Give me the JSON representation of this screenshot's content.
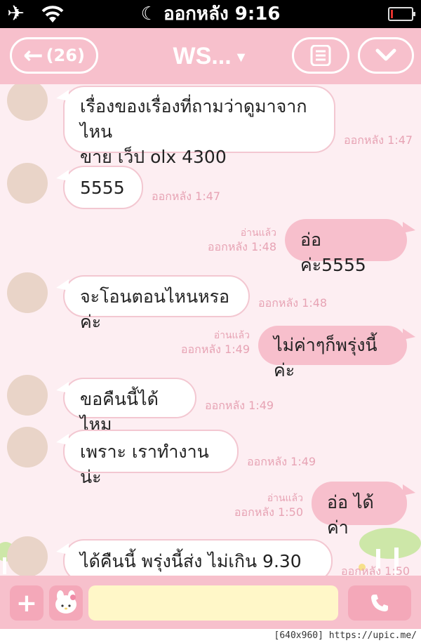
{
  "status_bar": {
    "time": "ออกหลัง 9:16",
    "clock_icon": "moon-icon",
    "signal": "wifi-icon",
    "mode": "airplane-icon",
    "battery_level": 0.1
  },
  "header": {
    "back_label": "(26)",
    "title": "WS...",
    "back_icon": "arrow-left-icon",
    "menu_icon": "menu-icon",
    "expand_icon": "chevron-down-icon"
  },
  "messages": [
    {
      "from": "them",
      "lines": [
        "เรื่องของเรื่องที่ถามว่าดูมาจากไหน",
        "ขาย  เว็ป  olx  4300"
      ],
      "time": "ออกหลัง 1:47"
    },
    {
      "from": "them",
      "text": "5555",
      "time": "ออกหลัง 1:47"
    },
    {
      "from": "me",
      "text": "อ่อ  ค่ะ5555",
      "read": "อ่านแล้ว",
      "time": "ออกหลัง 1:48"
    },
    {
      "from": "them",
      "text": "จะโอนตอนไหนหรอค่ะ",
      "time": "ออกหลัง 1:48"
    },
    {
      "from": "me",
      "text": "ไม่ค่าๆก็พรุ่งนี้ค่ะ",
      "read": "อ่านแล้ว",
      "time": "ออกหลัง 1:49"
    },
    {
      "from": "them",
      "text": "ขอคืนนี้ได้ไหม",
      "time": "ออกหลัง 1:49"
    },
    {
      "from": "them",
      "text": "เพราะ  เราทำงานน่ะ",
      "time": "ออกหลัง 1:49"
    },
    {
      "from": "me",
      "text": "อ่อ  ได้ค่า",
      "read": "อ่านแล้ว",
      "time": "ออกหลัง 1:50"
    },
    {
      "from": "them",
      "text": "ได้คืนนี้   พรุ่งนี้ส่ง  ไม่เกิน  9.30",
      "time": "ออกหลัง 1:50"
    }
  ],
  "input_bar": {
    "add_icon": "plus-icon",
    "sticker_icon": "my-melody-sticker-icon",
    "call_icon": "phone-icon",
    "message_placeholder": ""
  },
  "watermark": "[640x960] https://upic.me/",
  "colors": {
    "header": "#f7c0cc",
    "outgoing_bubble": "#f7bfcc",
    "background": "#fdeef2",
    "timestamp": "#e7a3b4",
    "input_field": "#fff7c8"
  }
}
